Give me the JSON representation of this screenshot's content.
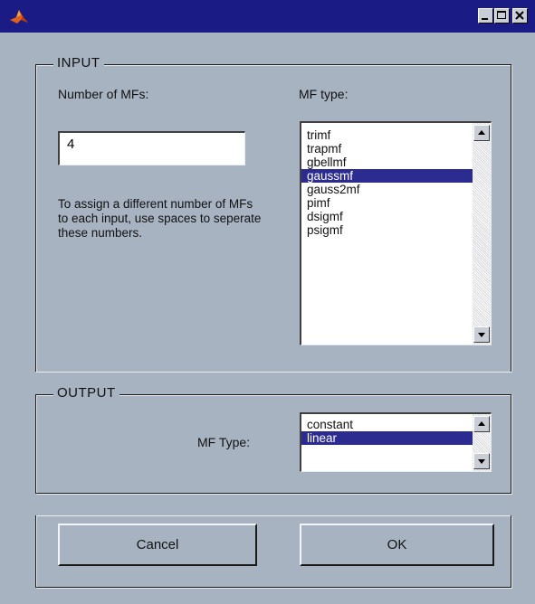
{
  "window": {
    "title": ""
  },
  "titlebar": {
    "icon": "matlab-icon",
    "buttons": [
      "minimize-icon",
      "maximize-icon",
      "close-icon"
    ]
  },
  "input": {
    "legend": "INPUT",
    "num_mfs_label": "Number of MFs:",
    "num_mfs_value": "4",
    "mf_type_label": "MF type:",
    "hint": "To assign a different number of MFs to each input, use spaces to seperate these numbers.",
    "mf_types": [
      "trimf",
      "trapmf",
      "gbellmf",
      "gaussmf",
      "gauss2mf",
      "pimf",
      "dsigmf",
      "psigmf"
    ],
    "selected_index": 3
  },
  "output": {
    "legend": "OUTPUT",
    "mf_type_label": "MF Type:",
    "mf_types": [
      "constant",
      "linear"
    ],
    "selected_index": 1
  },
  "buttons": {
    "cancel": "Cancel",
    "ok": "OK"
  },
  "colors": {
    "background": "#a8b3c2",
    "titlebar": "#1b1b86",
    "selection": "#2b2b90"
  }
}
